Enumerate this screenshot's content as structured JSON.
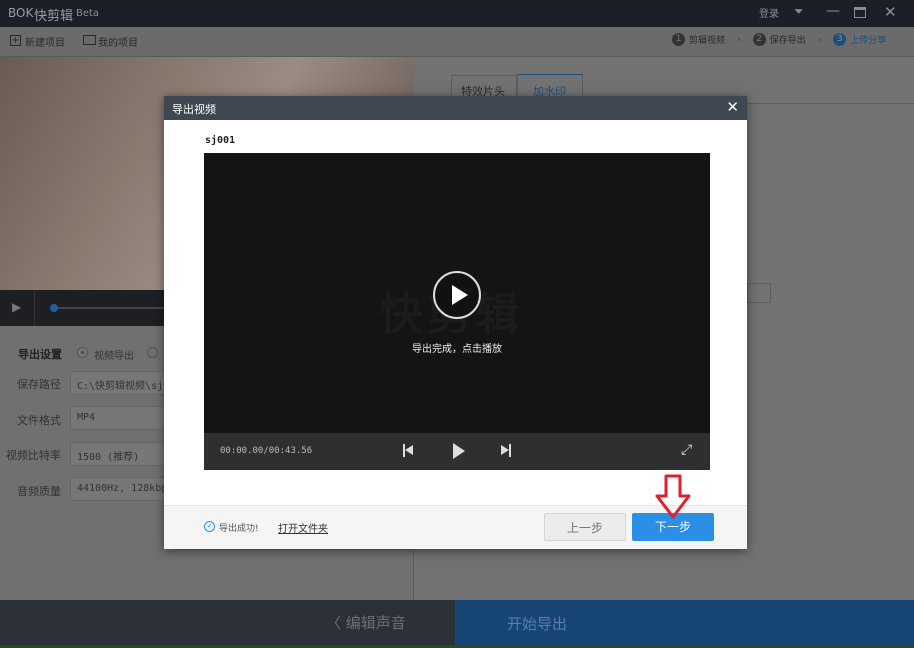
{
  "app": {
    "logo": "BOK",
    "title": "快剪辑",
    "beta": "Beta",
    "login": "登录"
  },
  "toolbar": {
    "new_project": "新建项目",
    "my_projects": "我的项目",
    "steps": [
      {
        "num": "1",
        "label": "剪辑视频"
      },
      {
        "num": "2",
        "label": "保存导出"
      },
      {
        "num": "3",
        "label": "上传分享"
      }
    ]
  },
  "tabs": [
    "特效片头",
    "加水印"
  ],
  "settings": {
    "section": "导出设置",
    "radio_video": "视频导出",
    "rows": [
      {
        "label": "保存路径",
        "value": "C:\\快剪辑视频\\sj0"
      },
      {
        "label": "文件格式",
        "value": "MP4"
      },
      {
        "label": "视频比特率",
        "value": "1500 (推荐)"
      },
      {
        "label": "音频质量",
        "value": "44100Hz, 128kbps"
      }
    ]
  },
  "bottom": {
    "back": "编辑声音",
    "export": "开始导出"
  },
  "modal": {
    "title": "导出视频",
    "filename": "sj001",
    "watermark": "快剪辑",
    "status_text": "导出完成，点击播放",
    "time": "00:00.00/00:43.56",
    "success": "导出成功!",
    "open_folder": "打开文件夹",
    "prev": "上一步",
    "next": "下一步"
  },
  "colors": {
    "accent": "#2b8fe8",
    "modal_header": "#3f4753",
    "arrow": "#e0202a"
  }
}
